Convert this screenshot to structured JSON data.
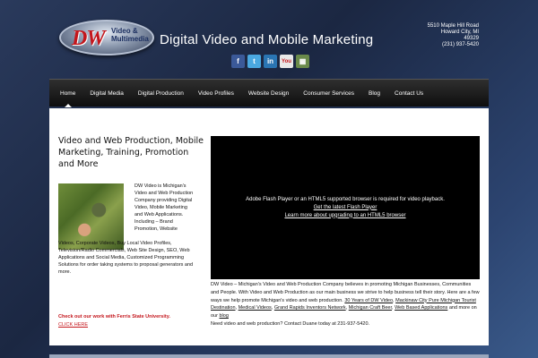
{
  "header": {
    "logo": {
      "dw": "DW",
      "sub": "Video & Multimedia"
    },
    "title": "Digital Video and Mobile Marketing",
    "address": {
      "line1": "5510 Maple Hill Road",
      "line2": "Howard City, MI",
      "line3": "49329",
      "phone": "(231) 937-5420"
    },
    "social": [
      {
        "icon": "facebook-icon",
        "glyph": "f"
      },
      {
        "icon": "twitter-icon",
        "glyph": "t"
      },
      {
        "icon": "linkedin-icon",
        "glyph": "in"
      },
      {
        "icon": "youtube-icon",
        "glyph": "You"
      },
      {
        "icon": "feed-icon",
        "glyph": "▦"
      }
    ]
  },
  "nav": {
    "items": [
      "Home",
      "Digital Media",
      "Digital Production",
      "Video Profiles",
      "Website Design",
      "Consumer Services",
      "Blog",
      "Contact Us"
    ],
    "active": "Home"
  },
  "main": {
    "heading": "Video and Web Production,  Mobile Marketing, Training, Promotion and More",
    "intro_side": "DW Video is Michigan's Video and Web Production Company providing Digital Video, Mobile Marketing and Web Applications.  Including – Brand Promotion, Website",
    "intro_rest": "Videos, Corporate Videos, Buy Local Video Profiles, Television/Radio Commercials, Web Site Design, SEO, Web Applications and Social Media, Customized Programming Solutions for order taking systems to proposal generators and more.",
    "ferris": "Check out our work with Ferris State University.",
    "click_here": "CLICK HERE",
    "video": {
      "message": "Adobe Flash Player or an HTML5 supported browser is required for video playback.",
      "link1": "Get the latest Flash Player",
      "link2": "Learn more about upgrading to an HTML5 browser"
    },
    "desc": {
      "text1": "DW Video – Michigan's Video and Web Production Company believes in promoting Michigan Businesses, Communities and People.  With Video and Web Production as our main business we strive to help business tell their story. Here are a few ways we help promote Michigan's video and web production.  ",
      "link1": "30 Years of DW Video",
      "sep1": ",  ",
      "link2": "Mackinaw City Pure Michigan Tourist Destination",
      "sep2": ", ",
      "link3": "Medical Videos",
      "sep3": ", ",
      "link4": "Grand Rapids Inventors Network",
      "sep4": ", ",
      "link5": "Michigan Craft Beer",
      "sep5": ", ",
      "link6": "Web Based Applications",
      "text2": " and more on our ",
      "link7": "blog",
      "text3": "Need video and web production?  Contact Duane today at 231-937-5420."
    }
  }
}
